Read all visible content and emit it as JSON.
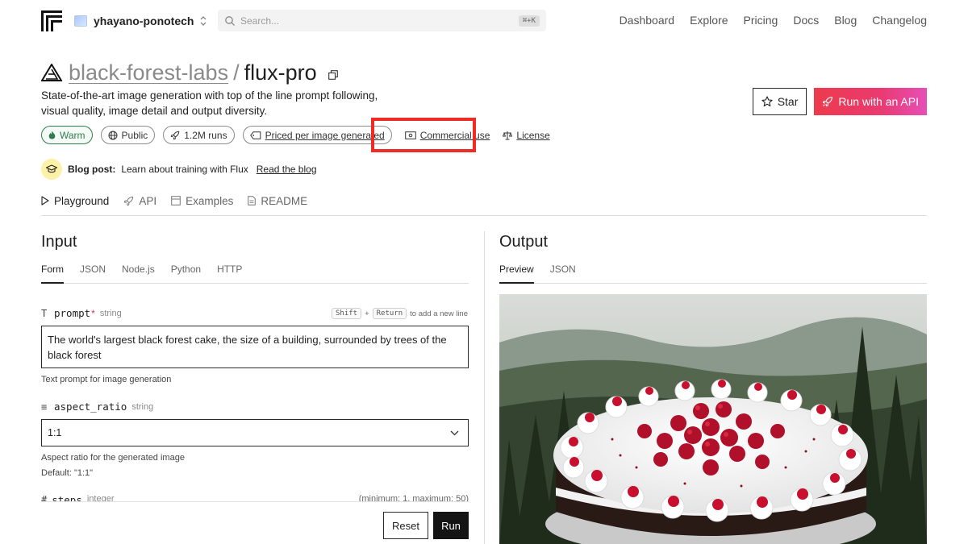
{
  "topnav": {
    "workspace_name": "yhayano-ponotech",
    "search_placeholder": "Search...",
    "search_shortcut": "⌘+K",
    "links": [
      "Dashboard",
      "Explore",
      "Pricing",
      "Docs",
      "Blog",
      "Changelog"
    ]
  },
  "model": {
    "owner": "black-forest-labs",
    "separator": "/",
    "name": "flux-pro",
    "description": "State-of-the-art image generation with top of the line prompt following, visual quality, image detail and output diversity."
  },
  "actions": {
    "star_label": "Star",
    "run_api_label": "Run with an API"
  },
  "badges": {
    "warm": "Warm",
    "public": "Public",
    "runs": "1.2M runs",
    "pricing": "Priced per image generated",
    "commercial": "Commercial use",
    "license": "License"
  },
  "blog": {
    "prefix": "Blog post:",
    "text": "Learn about training with Flux",
    "link": "Read the blog"
  },
  "main_tabs": [
    "Playground",
    "API",
    "Examples",
    "README"
  ],
  "input": {
    "title": "Input",
    "tabs": [
      "Form",
      "JSON",
      "Node.js",
      "Python",
      "HTTP"
    ],
    "prompt": {
      "icon": "T",
      "name": "prompt",
      "required": "*",
      "type": "string",
      "hint_key1": "Shift",
      "hint_plus": "+",
      "hint_key2": "Return",
      "hint_text": "to add a new line",
      "value": "The world's largest black forest cake, the size of a building, surrounded by trees of the black forest",
      "help": "Text prompt for image generation"
    },
    "aspect_ratio": {
      "icon": "≡",
      "name": "aspect_ratio",
      "type": "string",
      "value": "1:1",
      "help": "Aspect ratio for the generated image",
      "default": "Default: \"1:1\""
    },
    "steps": {
      "icon": "#",
      "name": "steps",
      "type": "integer",
      "range": "(minimum: 1, maximum: 50)"
    },
    "reset_label": "Reset",
    "run_label": "Run"
  },
  "output": {
    "title": "Output",
    "tabs": [
      "Preview",
      "JSON"
    ]
  },
  "colors": {
    "accent_gradient_start": "#ec3b4b",
    "accent_gradient_end": "#e64fb8",
    "warm_green": "#2f7d4f",
    "highlight_red": "#ef2b25"
  }
}
